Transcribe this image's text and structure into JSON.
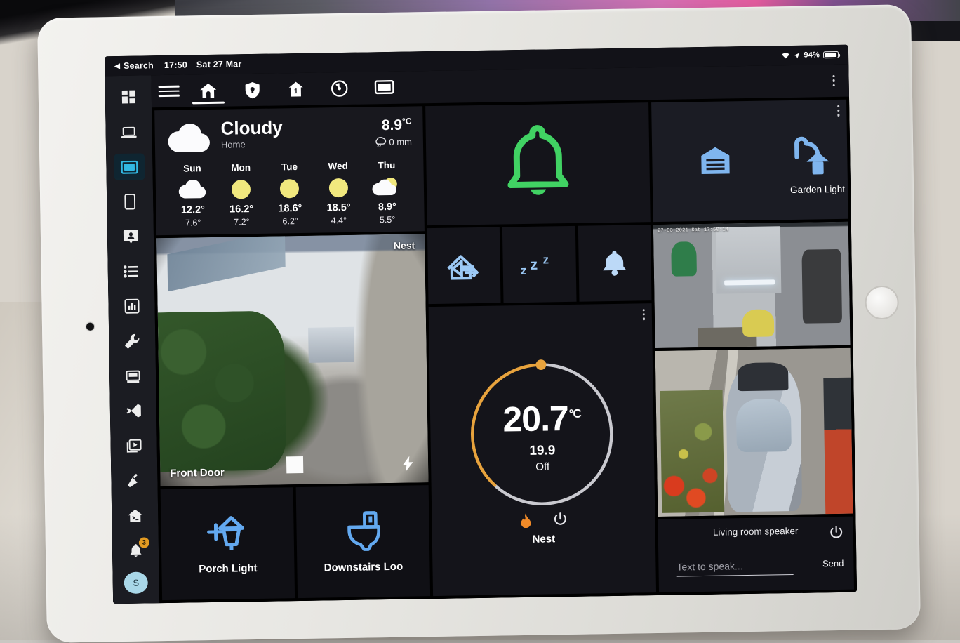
{
  "status_bar": {
    "back_label": "Search",
    "time": "17:50",
    "date": "Sat 27 Mar",
    "battery_percent": "94%",
    "wifi_icon": "wifi-icon",
    "location_icon": "location-arrow-icon",
    "battery_icon": "battery-icon"
  },
  "sidebar": {
    "items": [
      {
        "name": "overview",
        "icon": "grid-dashboard-icon",
        "active": false
      },
      {
        "name": "laptop-dashboard",
        "icon": "laptop-icon",
        "active": false
      },
      {
        "name": "tablet-dashboard",
        "icon": "tablet-landscape-icon",
        "active": true
      },
      {
        "name": "phone-dashboard",
        "icon": "phone-icon",
        "active": false
      },
      {
        "name": "contacts",
        "icon": "person-card-icon",
        "active": false
      },
      {
        "name": "logbook",
        "icon": "list-icon",
        "active": false
      },
      {
        "name": "history",
        "icon": "bar-chart-icon",
        "active": false
      },
      {
        "name": "settings",
        "icon": "wrench-icon",
        "active": false
      },
      {
        "name": "hacs",
        "icon": "hacs-store-icon",
        "active": false
      },
      {
        "name": "vscode",
        "icon": "vscode-icon",
        "active": false
      },
      {
        "name": "media",
        "icon": "media-player-icon",
        "active": false
      },
      {
        "name": "developer-tools",
        "icon": "hammer-icon",
        "active": false
      },
      {
        "name": "terminal-home",
        "icon": "home-terminal-icon",
        "active": false
      }
    ],
    "notifications": {
      "icon": "bell-icon",
      "badge": "3"
    },
    "user_avatar": "S"
  },
  "topbar": {
    "menu_icon": "hamburger-icon",
    "overflow_icon": "kebab-menu-icon",
    "tabs": [
      {
        "name": "home",
        "icon": "home-icon",
        "active": true
      },
      {
        "name": "security",
        "icon": "shield-lock-icon",
        "active": false
      },
      {
        "name": "house-info",
        "icon": "house-number-icon",
        "active": false
      },
      {
        "name": "climate",
        "icon": "gauge-icon",
        "active": false
      },
      {
        "name": "media",
        "icon": "monitor-icon",
        "active": false
      }
    ]
  },
  "weather": {
    "condition": "Cloudy",
    "location": "Home",
    "temperature": "8.9",
    "temperature_unit": "°C",
    "precipitation": "0 mm",
    "precip_icon": "rain-cloud-icon",
    "condition_icon": "cloud-icon",
    "forecast": [
      {
        "day": "Sun",
        "icon": "cloud-icon",
        "high": "12.2°",
        "low": "7.6°"
      },
      {
        "day": "Mon",
        "icon": "sun-icon",
        "high": "16.2°",
        "low": "7.2°"
      },
      {
        "day": "Tue",
        "icon": "sun-icon",
        "high": "18.6°",
        "low": "6.2°"
      },
      {
        "day": "Wed",
        "icon": "sun-icon",
        "high": "18.5°",
        "low": "4.4°"
      },
      {
        "day": "Thu",
        "icon": "partly-cloudy-icon",
        "high": "8.9°",
        "low": "5.5°"
      }
    ]
  },
  "doorbell_camera": {
    "label": "Front Door",
    "brand": "Nest",
    "snapshot_button_icon": "snapshot-square-icon",
    "flash_icon": "lightning-bolt-icon"
  },
  "light_tiles": [
    {
      "label": "Porch Light",
      "icon": "wall-lantern-icon",
      "color": "#63a9f0"
    },
    {
      "label": "Downstairs Loo",
      "icon": "toilet-icon",
      "color": "#63a9f0"
    }
  ],
  "alarm": {
    "icon": "bell-icon",
    "color": "#41d263",
    "state_name": "alarm-ring"
  },
  "scenes": [
    {
      "name": "away-mode",
      "icon": "home-export-icon",
      "color": "#9cc9f5"
    },
    {
      "name": "sleep-mode",
      "icon": "sleep-zzz-icon",
      "color": "#9cc9f5"
    },
    {
      "name": "doorbell-chime",
      "icon": "bell-solid-icon",
      "color": "#bcd9f7"
    }
  ],
  "thermostat": {
    "target_temperature": "20.7",
    "unit": "°C",
    "current_temperature": "19.9",
    "state": "Off",
    "name": "Nest",
    "heat_icon": "flame-icon",
    "power_icon": "power-icon",
    "overflow_icon": "kebab-menu-icon",
    "arc_color": "#e8a33d",
    "track_color": "#c9c9cf"
  },
  "right_panel": {
    "garage_icon": "garage-door-icon",
    "garden_light": {
      "label": "Garden Light",
      "icon": "outdoor-lamp-icon"
    },
    "overflow_icon": "kebab-menu-icon",
    "accent": "#63a9f0"
  },
  "garage_camera": {
    "timestamp": "27-03-2021 Sat 17:50:14"
  },
  "driveway_camera": {
    "timestamp": ""
  },
  "speaker": {
    "name": "Living room speaker",
    "placeholder": "Text to speak...",
    "send_label": "Send",
    "power_icon": "power-icon"
  }
}
